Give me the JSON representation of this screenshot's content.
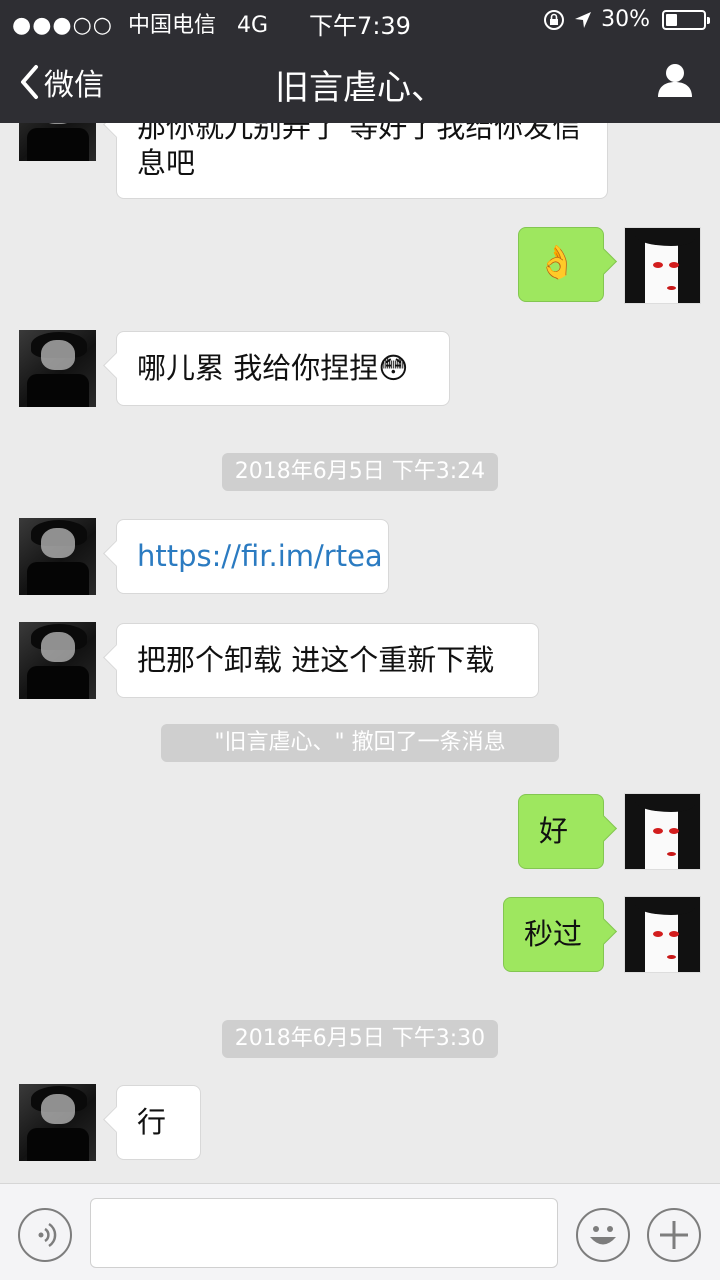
{
  "status_bar": {
    "signal": "●●●○○",
    "carrier": "中国电信",
    "network": "4G",
    "time": "下午7:39",
    "battery": "30%",
    "battery_level": 0.3
  },
  "nav": {
    "back_label": "微信",
    "title": "旧言虐心、"
  },
  "messages": [
    {
      "text": "那你就九别弄了 等好了我给你发信息吧"
    },
    {
      "text": "👌"
    },
    {
      "text": "哪儿累 我给你捏捏😳"
    },
    {
      "text": "2018年6月5日 下午3:24"
    },
    {
      "text": "https://fir.im/rtea"
    },
    {
      "text": "把那个卸载 进这个重新下载"
    },
    {
      "text": "\"旧言虐心、\" 撤回了一条消息"
    },
    {
      "text": "好"
    },
    {
      "text": "秒过"
    },
    {
      "text": "2018年6月5日 下午3:30"
    },
    {
      "text": "行"
    }
  ],
  "colors": {
    "header_bg": "#2e2e33",
    "chat_bg": "#ebebeb",
    "outgoing_bubble": "#9ee75f",
    "incoming_bubble": "#ffffff",
    "link": "#2b7bc1"
  }
}
